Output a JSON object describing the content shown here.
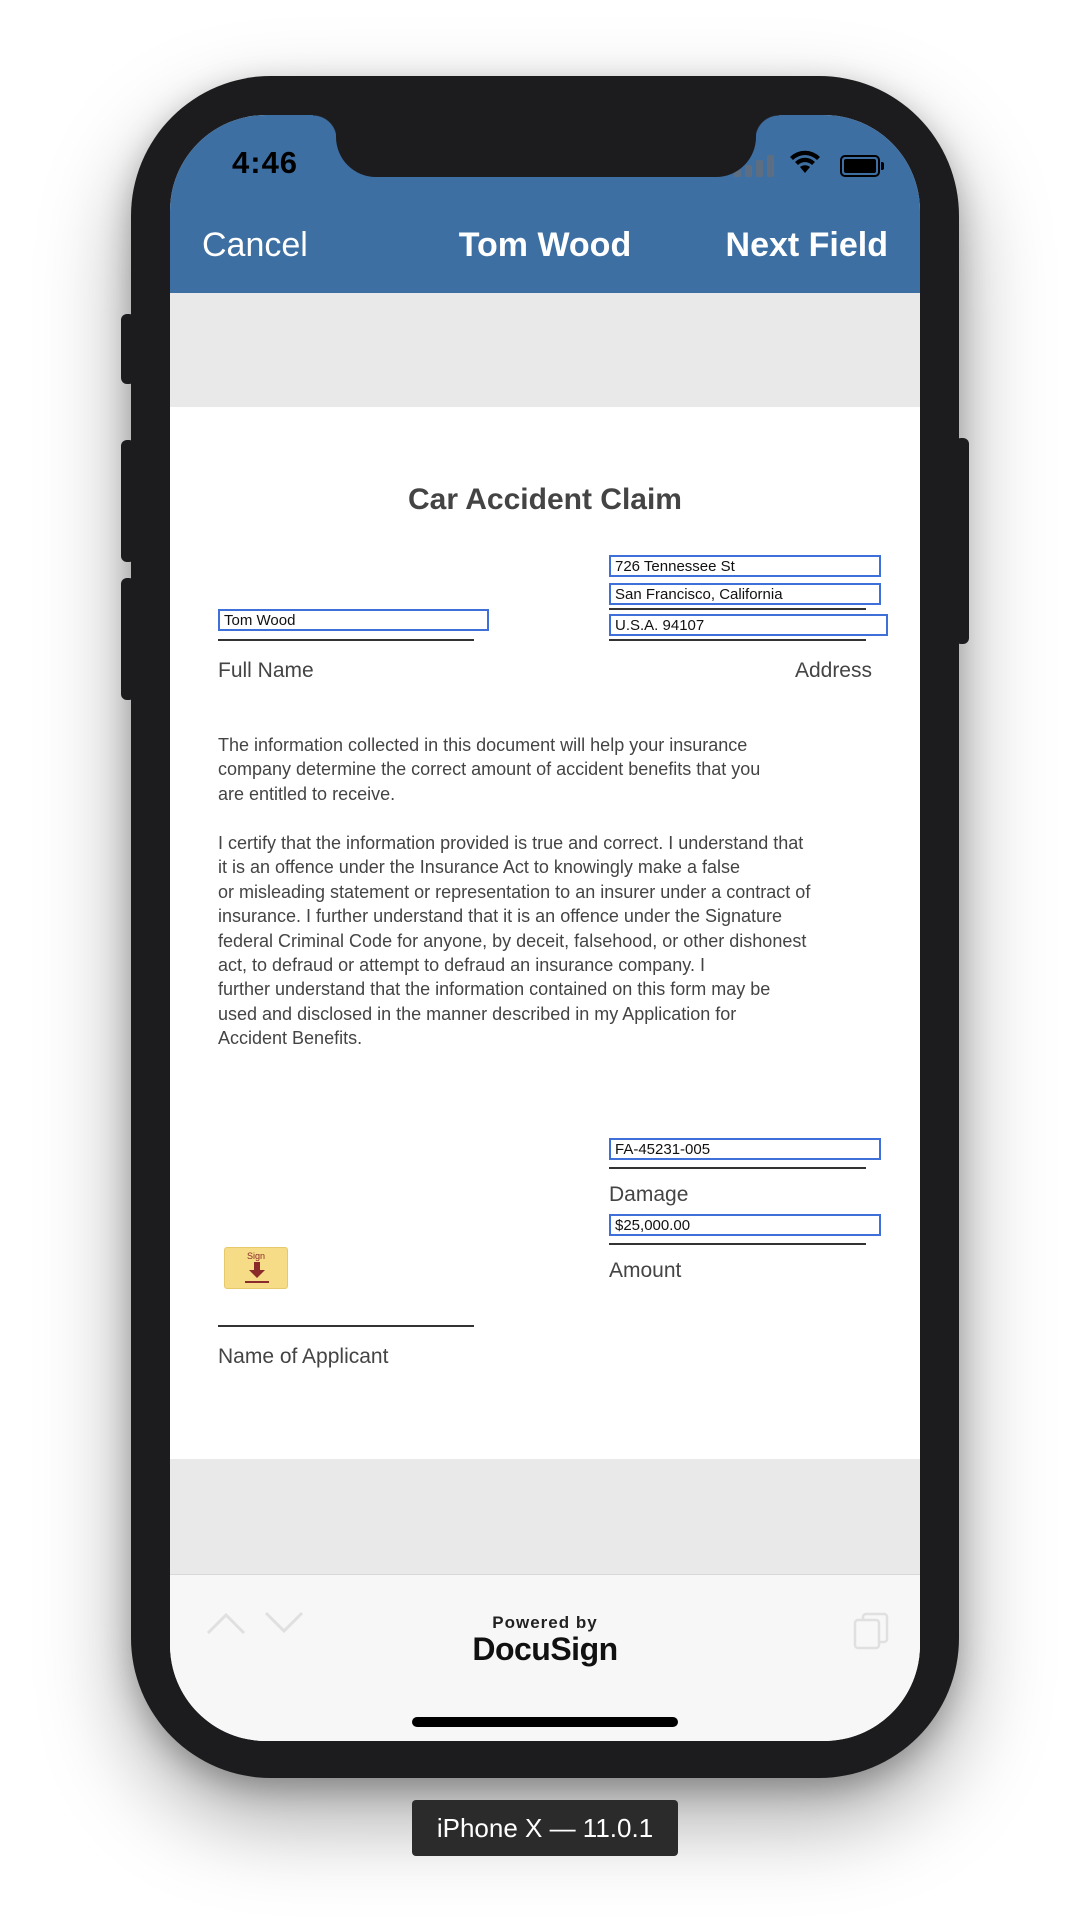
{
  "status_bar": {
    "time": "4:46"
  },
  "nav": {
    "cancel": "Cancel",
    "title": "Tom Wood",
    "next": "Next Field"
  },
  "document": {
    "title": "Car Accident Claim",
    "fields": {
      "full_name": "Tom Wood",
      "address_line1": "726 Tennessee St",
      "address_line2": "San Francisco, California",
      "address_line3": "U.S.A. 94107",
      "damage": "FA-45231-005",
      "amount": "$25,000.00"
    },
    "labels": {
      "full_name": "Full Name",
      "address": "Address",
      "damage": "Damage",
      "amount": "Amount",
      "applicant": "Name of Applicant"
    },
    "paragraph1": "The information collected in this document will help your insurance\ncompany determine the correct amount of accident benefits that you\nare entitled to receive.",
    "paragraph2": "I certify that the information provided is true and correct. I understand that\nit is an offence under the Insurance Act to knowingly make a false\nor misleading statement or representation to an insurer under a contract of\ninsurance. I further understand that it is an offence under the Signature\nfederal Criminal Code for anyone, by deceit, falsehood, or other dishonest\nact, to defraud or attempt to defraud an insurance company. I\nfurther understand that the information contained on this form may be\nused and disclosed in the manner described in my Application for\nAccident Benefits.",
    "sign_tab": "Sign"
  },
  "footer": {
    "powered_by": "Powered by",
    "brand": "DocuSign",
    "icons": [
      "chevron-up-icon",
      "chevron-down-icon",
      "copy-icon"
    ]
  },
  "simulator_label": "iPhone X — 11.0.1",
  "colors": {
    "nav_bar": "#3e6fa3",
    "field_border": "#3f6fd8",
    "sign_tab": "#f6dc86"
  }
}
